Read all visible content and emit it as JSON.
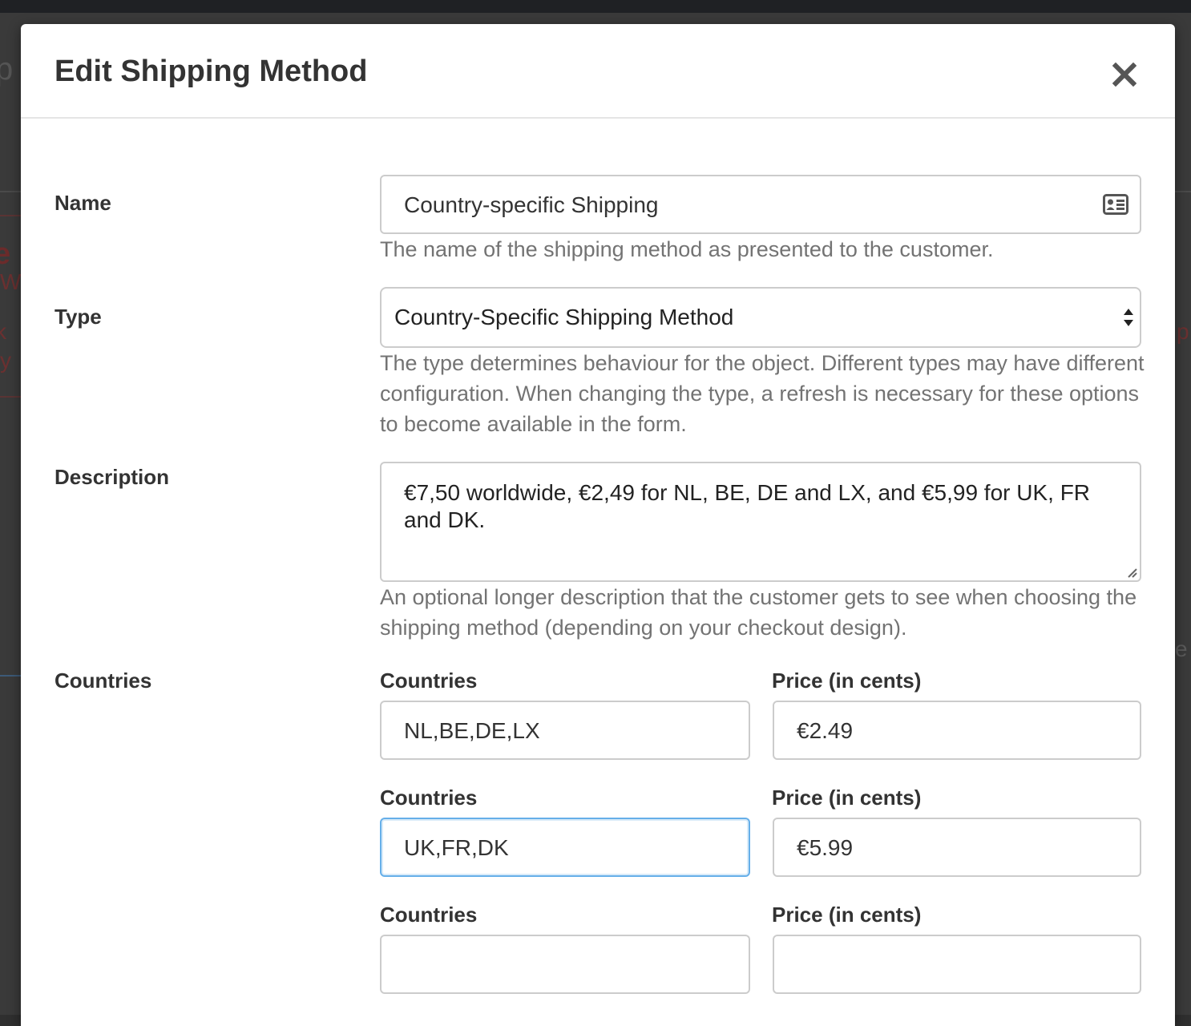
{
  "modal": {
    "title": "Edit Shipping Method",
    "close_icon": "close-icon"
  },
  "fields": {
    "name": {
      "label": "Name",
      "value": "Country-specific Shipping",
      "icon": "contact-card-icon",
      "help": "The name of the shipping method as presented to the customer."
    },
    "type": {
      "label": "Type",
      "value": "Country-Specific Shipping Method",
      "help": "The type determines behaviour for the object. Different types may have different configuration. When changing the type, a refresh is necessary for these options to become available in the form."
    },
    "description": {
      "label": "Description",
      "value": "€7,50 worldwide, €2,49 for NL, BE, DE and LX, and €5,99 for UK, FR and DK.",
      "help": "An optional longer description that the customer gets to see when choosing the shipping method (depending on your checkout design)."
    },
    "countries": {
      "label": "Countries",
      "rows": [
        {
          "countries_label": "Countries",
          "countries_value": "NL,BE,DE,LX",
          "price_label": "Price (in cents)",
          "price_value": "€2.49"
        },
        {
          "countries_label": "Countries",
          "countries_value": "UK,FR,DK",
          "price_label": "Price (in cents)",
          "price_value": "€5.99"
        },
        {
          "countries_label": "Countries",
          "countries_value": "",
          "price_label": "Price (in cents)",
          "price_value": ""
        }
      ]
    }
  },
  "colors": {
    "focus_border": "#66afe9",
    "label_text": "#333333",
    "help_text": "#737373",
    "input_border": "#cccccc"
  }
}
